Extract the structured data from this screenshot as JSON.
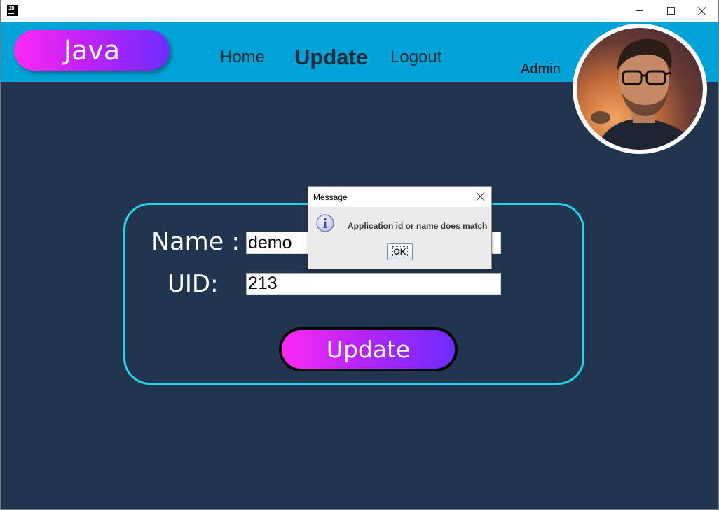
{
  "app": {
    "icon_text": "JB",
    "window_controls": [
      "minimize-icon",
      "maximize-icon",
      "close-icon"
    ]
  },
  "header": {
    "brand": "Java",
    "nav": [
      {
        "label": "Home"
      },
      {
        "label": "Update"
      },
      {
        "label": "Logout"
      }
    ],
    "user": "Admin"
  },
  "form": {
    "name_label": "Name :",
    "name_value": "demo",
    "uid_label": "UID:",
    "uid_value": "213",
    "submit_label": "Update"
  },
  "dialog": {
    "title": "Message",
    "icon": "info-icon",
    "message": "Application id or name does match",
    "ok_label": "OK"
  },
  "colors": {
    "header": "#00a3d7",
    "background": "#22354e",
    "card_border": "#1fd4ee",
    "gradient_start": "#ff29f4",
    "gradient_end": "#6e2bff"
  }
}
